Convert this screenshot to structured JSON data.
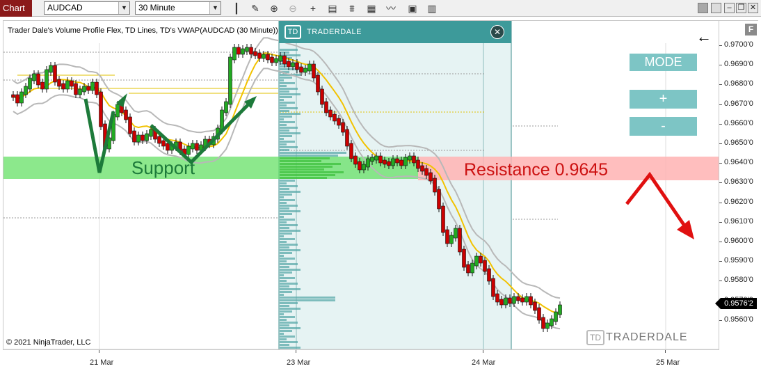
{
  "toolbar": {
    "tab_label": "Chart",
    "instrument": "AUDCAD",
    "timeframe": "30 Minute",
    "icons": [
      "bar-type-icon",
      "pencil-icon",
      "zoom-in-icon",
      "zoom-out-icon",
      "crosshair-icon",
      "properties-icon",
      "indicators-icon",
      "strategy-icon",
      "data-box-icon",
      "chart-trader-icon"
    ],
    "window_icons": [
      "minimize-icon",
      "restore-icon",
      "maximize-icon",
      "close-icon"
    ]
  },
  "chart": {
    "title": "Trader Dale's Volume Profile Flex, TD Lines, TD's VWAP(AUDCAD (30 Minute))",
    "copyright": "© 2021 NinjaTrader, LLC",
    "current_price": "0.9576'2",
    "price_labels": [
      "0.9700'0",
      "0.9690'0",
      "0.9680'0",
      "0.9670'0",
      "0.9660'0",
      "0.9650'0",
      "0.9640'0",
      "0.9630'0",
      "0.9620'0",
      "0.9610'0",
      "0.9600'0",
      "0.9590'0",
      "0.9580'0",
      "0.9570'0",
      "0.9560'0"
    ],
    "date_labels": [
      "21 Mar",
      "23 Mar",
      "24 Mar",
      "25 Mar"
    ]
  },
  "panel": {
    "mode_label": "MODE",
    "plus_label": "+",
    "minus_label": "-",
    "back_icon": "arrow-left-icon"
  },
  "profile": {
    "brand": "TRADERDALE",
    "close_icon": "close-circle-icon"
  },
  "annotations": {
    "support": "Support",
    "resistance": "Resistance 0.9645"
  },
  "watermark": "TRADERDALE",
  "colors": {
    "tab": "#8b1a1a",
    "support_zone": "#66e066",
    "resistance_zone": "#ffb3b3",
    "profile_bg": "#e6f3f3",
    "profile_header": "#3d9a9a",
    "bull": "#22aa22",
    "bear": "#cc0000",
    "vwap": "#f2c200",
    "band": "#b0b0b0",
    "panel_button": "#7dc5c5"
  }
}
